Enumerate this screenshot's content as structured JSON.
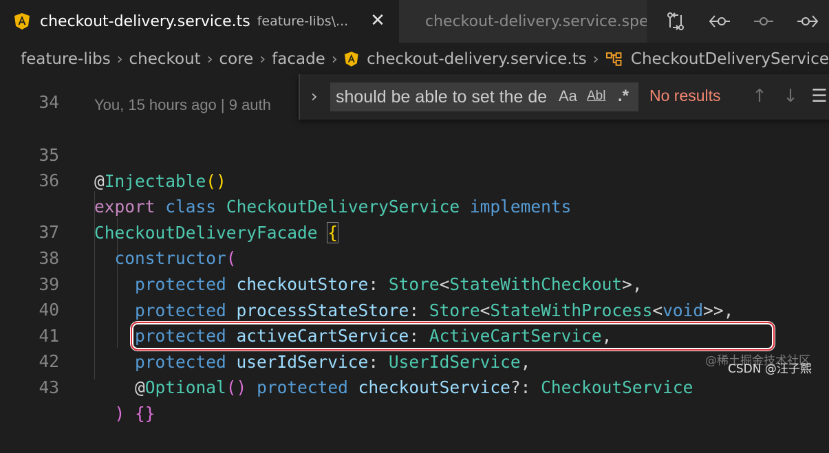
{
  "tabs": [
    {
      "name": "checkout-delivery.service.ts",
      "description": "feature-libs\\...",
      "icon": "angular-icon"
    },
    {
      "name": "checkout-delivery.service.spec.ts",
      "icon": "test-flask-icon"
    }
  ],
  "toolbar": {
    "icons": [
      "compare-changes-icon",
      "go-back-icon",
      "current-change-icon",
      "go-forward-icon"
    ]
  },
  "breadcrumb": [
    "feature-libs",
    "checkout",
    "core",
    "facade",
    "checkout-delivery.service.ts",
    "CheckoutDeliveryService"
  ],
  "find_widget": {
    "query": "should be able to set the de",
    "match_case": "Aa",
    "whole_word": "Abl",
    "regex": ".*",
    "status": "No results"
  },
  "codelens": "You, 15 hours ago | 9 auth",
  "lines": [
    {
      "num": "34",
      "tokens": []
    },
    {
      "num": "35",
      "tokens": [
        {
          "t": "@",
          "c": "k-at"
        },
        {
          "t": "Injectable",
          "c": "k-type"
        },
        {
          "t": "()",
          "c": "k-p1"
        }
      ]
    },
    {
      "num": "36",
      "tokens": [
        {
          "t": "export",
          "c": "k-ctrl"
        },
        {
          "t": " ",
          "c": "k-plain"
        },
        {
          "t": "class",
          "c": "k-kw"
        },
        {
          "t": " ",
          "c": "k-plain"
        },
        {
          "t": "CheckoutDeliveryService",
          "c": "k-type"
        },
        {
          "t": " ",
          "c": "k-plain"
        },
        {
          "t": "implements",
          "c": "k-kw"
        }
      ]
    },
    {
      "num": "",
      "tokens": [
        {
          "t": "CheckoutDeliveryFacade",
          "c": "k-type"
        },
        {
          "t": " ",
          "c": "k-plain"
        },
        {
          "t": "{",
          "c": "k-p1 bracket-match"
        }
      ]
    },
    {
      "num": "37",
      "tokens": [
        {
          "t": "  ",
          "c": "k-plain"
        },
        {
          "t": "constructor",
          "c": "k-kw"
        },
        {
          "t": "(",
          "c": "k-p2"
        }
      ]
    },
    {
      "num": "38",
      "tokens": [
        {
          "t": "    ",
          "c": "k-plain"
        },
        {
          "t": "protected",
          "c": "k-kw"
        },
        {
          "t": " ",
          "c": "k-plain"
        },
        {
          "t": "checkoutStore",
          "c": "k-var"
        },
        {
          "t": ": ",
          "c": "k-plain"
        },
        {
          "t": "Store",
          "c": "k-type"
        },
        {
          "t": "<",
          "c": "k-plain"
        },
        {
          "t": "StateWithCheckout",
          "c": "k-type"
        },
        {
          "t": ">,",
          "c": "k-plain"
        }
      ]
    },
    {
      "num": "39",
      "tokens": [
        {
          "t": "    ",
          "c": "k-plain"
        },
        {
          "t": "protected",
          "c": "k-kw"
        },
        {
          "t": " ",
          "c": "k-plain"
        },
        {
          "t": "processStateStore",
          "c": "k-var"
        },
        {
          "t": ": ",
          "c": "k-plain"
        },
        {
          "t": "Store",
          "c": "k-type"
        },
        {
          "t": "<",
          "c": "k-plain"
        },
        {
          "t": "StateWithProcess",
          "c": "k-type"
        },
        {
          "t": "<",
          "c": "k-plain"
        },
        {
          "t": "void",
          "c": "k-kw"
        },
        {
          "t": ">>,",
          "c": "k-plain"
        }
      ]
    },
    {
      "num": "40",
      "tokens": [
        {
          "t": "    ",
          "c": "k-plain"
        },
        {
          "t": "protected",
          "c": "k-kw"
        },
        {
          "t": " ",
          "c": "k-plain"
        },
        {
          "t": "activeCartService",
          "c": "k-var"
        },
        {
          "t": ": ",
          "c": "k-plain"
        },
        {
          "t": "ActiveCartService",
          "c": "k-type"
        },
        {
          "t": ",",
          "c": "k-plain"
        }
      ]
    },
    {
      "num": "41",
      "tokens": [
        {
          "t": "    ",
          "c": "k-plain"
        },
        {
          "t": "protected",
          "c": "k-kw"
        },
        {
          "t": " ",
          "c": "k-plain"
        },
        {
          "t": "userIdService",
          "c": "k-var"
        },
        {
          "t": ": ",
          "c": "k-plain"
        },
        {
          "t": "UserIdService",
          "c": "k-type"
        },
        {
          "t": ",",
          "c": "k-plain"
        }
      ]
    },
    {
      "num": "42",
      "tokens": [
        {
          "t": "    ",
          "c": "k-plain"
        },
        {
          "t": "@",
          "c": "k-at"
        },
        {
          "t": "Optional",
          "c": "k-type"
        },
        {
          "t": "()",
          "c": "k-p2"
        },
        {
          "t": " ",
          "c": "k-plain"
        },
        {
          "t": "protected",
          "c": "k-kw"
        },
        {
          "t": " ",
          "c": "k-plain"
        },
        {
          "t": "checkoutService",
          "c": "k-var"
        },
        {
          "t": "?: ",
          "c": "k-plain"
        },
        {
          "t": "CheckoutService",
          "c": "k-type"
        }
      ]
    },
    {
      "num": "43",
      "tokens": [
        {
          "t": "  ",
          "c": "k-plain"
        },
        {
          "t": ")",
          "c": "k-p2"
        },
        {
          "t": " ",
          "c": "k-plain"
        },
        {
          "t": "{}",
          "c": "k-p2"
        }
      ]
    }
  ],
  "watermark": "@稀土掘金技术社区",
  "watermark2": "CSDN @汪子熙"
}
